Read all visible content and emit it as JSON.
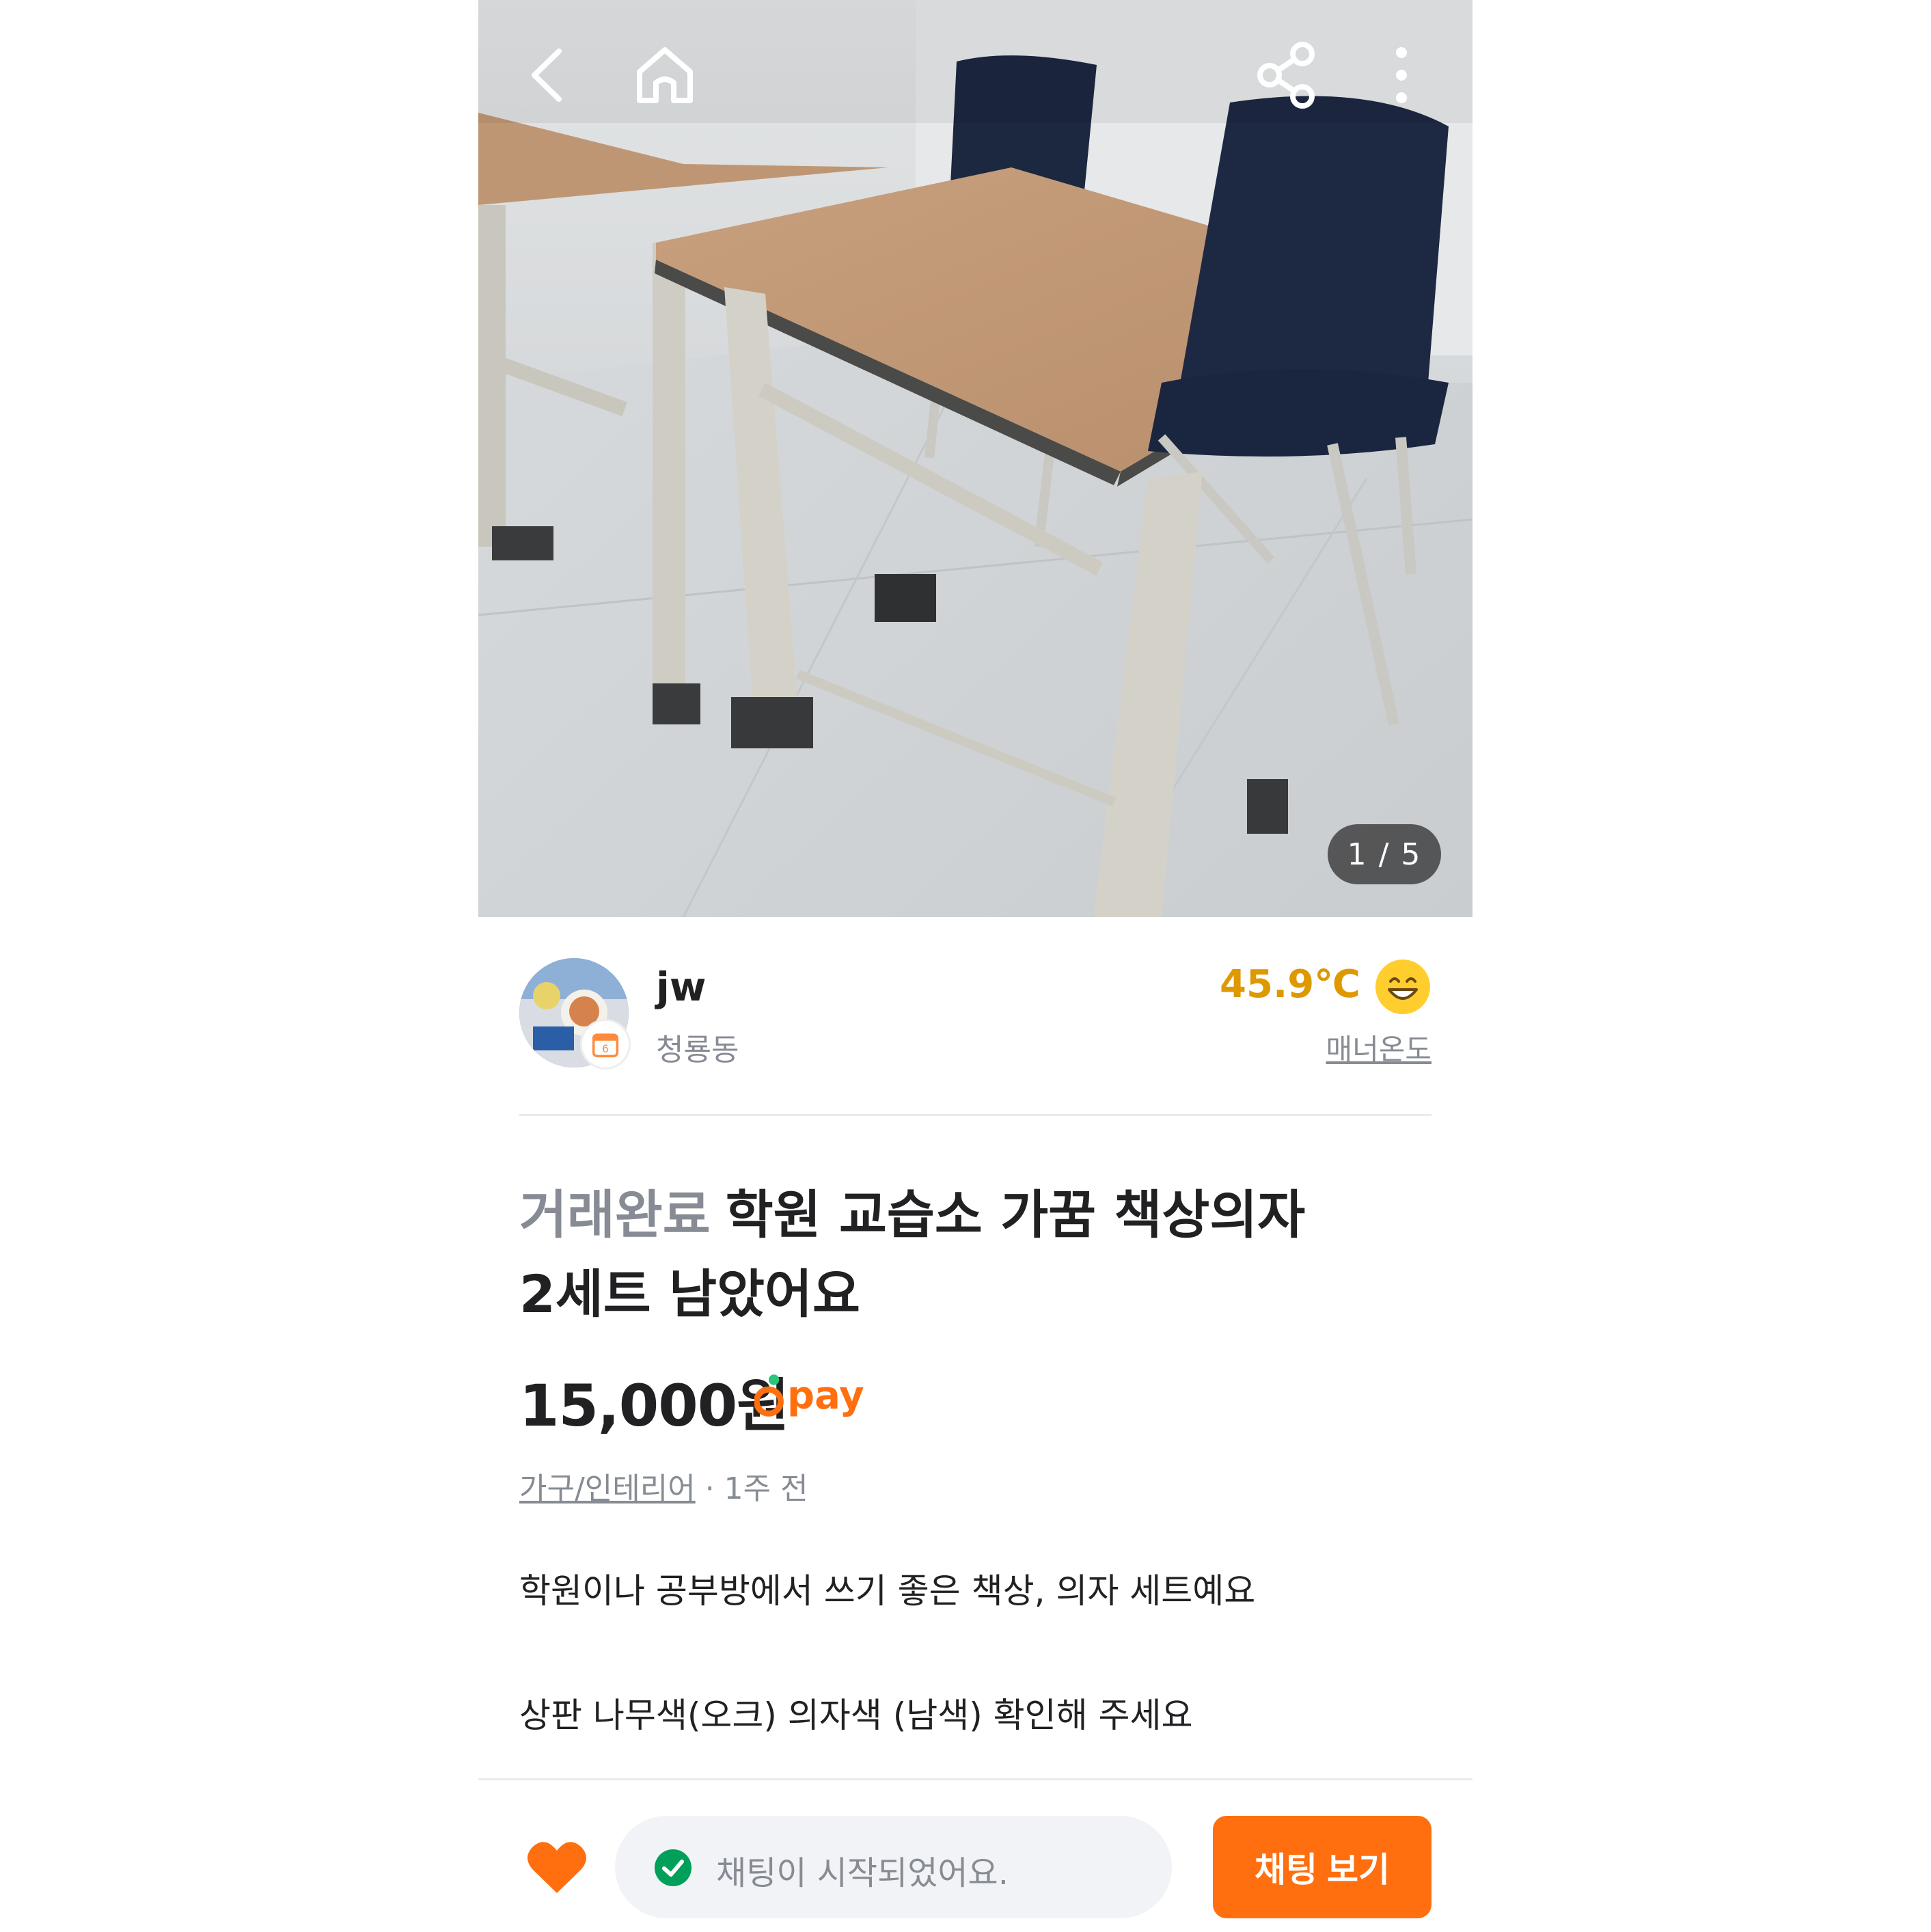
{
  "photo": {
    "counter": "1 / 5"
  },
  "seller": {
    "name": "jw",
    "location": "청룡동",
    "temperature": "45.9℃",
    "manner_label": "매너온도"
  },
  "listing": {
    "status": "거래완료",
    "title_line1": "학원 교습소 가꿈 책상의자",
    "title_line2": "2세트 남았어요",
    "price": "15,000원",
    "pay_label": "pay",
    "category": "가구/인테리어",
    "time": " · 1주 전",
    "description": [
      "학원이나 공부방에서 쓰기 좋은 책상, 의자 세트예요",
      "상판 나무색(오크) 의자색 (남색) 확인해 주세요"
    ]
  },
  "bottom": {
    "chat_status": "채팅이 시작되었어요.",
    "chat_button": "채팅 보기"
  },
  "colors": {
    "accent": "#ff6f0f",
    "temperature": "#de9800",
    "muted": "#868b94"
  },
  "icons": [
    "back-icon",
    "home-icon",
    "share-icon",
    "more-icon",
    "heart-icon",
    "check-circle-icon",
    "smile-face-icon",
    "karrot-pay-icon"
  ]
}
